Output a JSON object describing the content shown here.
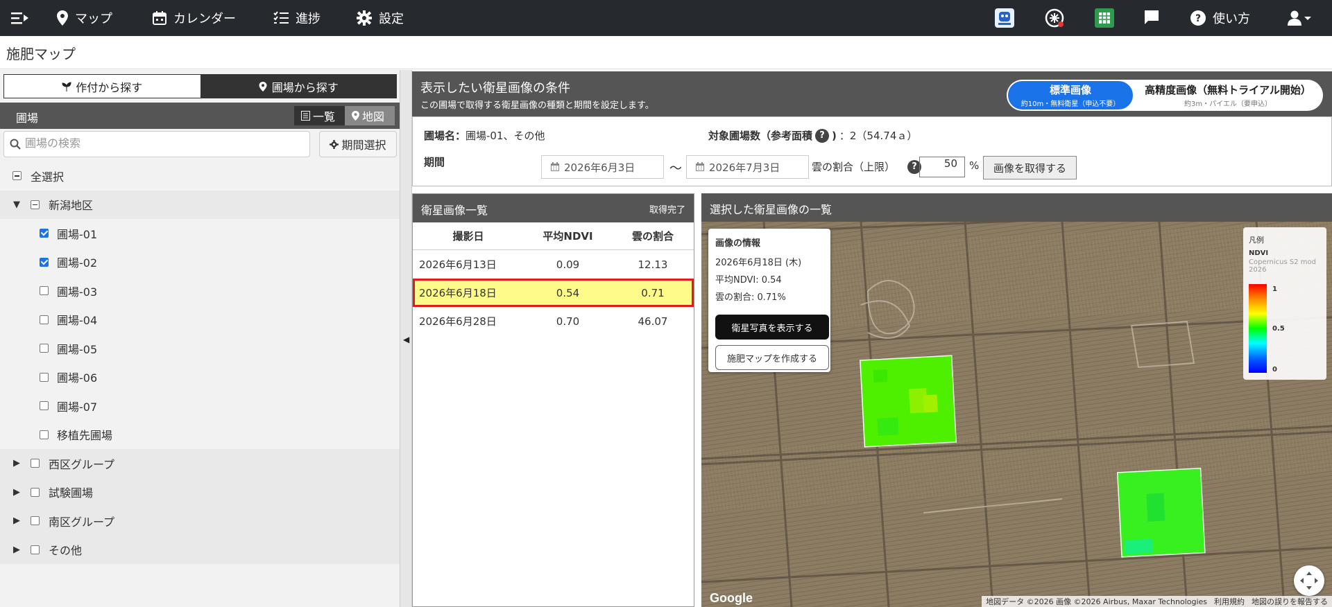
{
  "nav": {
    "map": "マップ",
    "calendar": "カレンダー",
    "progress": "進捗",
    "settings": "設定",
    "help": "使い方"
  },
  "page_title": "施肥マップ",
  "sidebar": {
    "tab_crop": "作付から探す",
    "tab_field": "圃場から探す",
    "section_label": "圃場",
    "view_list": "一覧",
    "view_map": "地図",
    "search_placeholder": "圃場の検索",
    "period_button": "期間選択",
    "tree": [
      {
        "label": "全選択",
        "level": 0,
        "state": "indet",
        "arrow": "",
        "shade": false
      },
      {
        "label": "新潟地区",
        "level": 1,
        "state": "indet",
        "arrow": "▼",
        "shade": true
      },
      {
        "label": "圃場-01",
        "level": 2,
        "state": "checked",
        "arrow": "",
        "shade": false
      },
      {
        "label": "圃場-02",
        "level": 2,
        "state": "checked",
        "arrow": "",
        "shade": false
      },
      {
        "label": "圃場-03",
        "level": 2,
        "state": "unchecked",
        "arrow": "",
        "shade": false
      },
      {
        "label": "圃場-04",
        "level": 2,
        "state": "unchecked",
        "arrow": "",
        "shade": false
      },
      {
        "label": "圃場-05",
        "level": 2,
        "state": "unchecked",
        "arrow": "",
        "shade": false
      },
      {
        "label": "圃場-06",
        "level": 2,
        "state": "unchecked",
        "arrow": "",
        "shade": false
      },
      {
        "label": "圃場-07",
        "level": 2,
        "state": "unchecked",
        "arrow": "",
        "shade": false
      },
      {
        "label": "移植先圃場",
        "level": 2,
        "state": "unchecked",
        "arrow": "",
        "shade": false
      },
      {
        "label": "西区グループ",
        "level": 1,
        "state": "unchecked",
        "arrow": "▶",
        "shade": true
      },
      {
        "label": "試験圃場",
        "level": 1,
        "state": "unchecked",
        "arrow": "▶",
        "shade": true
      },
      {
        "label": "南区グループ",
        "level": 1,
        "state": "unchecked",
        "arrow": "▶",
        "shade": true
      },
      {
        "label": "その他",
        "level": 1,
        "state": "unchecked",
        "arrow": "▶",
        "shade": true
      }
    ]
  },
  "conditions": {
    "title": "表示したい衛星画像の条件",
    "subtitle": "この圃場で取得する衛星画像の種類と期間を設定します。",
    "toggle_standard": "標準画像",
    "toggle_standard_sub": "約10m・無料衛星（申込不要）",
    "toggle_hires": "高精度画像（無料トライアル開始）",
    "toggle_hires_sub": "約3m・パイエル（要申込）",
    "field_name_label": "圃場名：",
    "field_name_value": "圃場-01、その他",
    "target_count_label": "対象圃場数（参考面積",
    "target_count_value": "：2（54.74ａ）",
    "period_label": "期間",
    "date_from": "2026年6月3日",
    "tilde": "～",
    "date_to": "2026年7月3日",
    "cloud_label": "雲の割合（上限）",
    "cloud_value": "50",
    "percent": "%",
    "get_button": "画像を取得する"
  },
  "satellite_list": {
    "title": "衛星画像一覧",
    "status": "取得完了",
    "headers": [
      "撮影日",
      "平均NDVI",
      "雲の割合"
    ],
    "rows": [
      {
        "date": "2026年6月13日",
        "ndvi": "0.09",
        "cloud": "12.13",
        "selected": false
      },
      {
        "date": "2026年6月18日",
        "ndvi": "0.54",
        "cloud": "0.71",
        "selected": true
      },
      {
        "date": "2026年6月28日",
        "ndvi": "0.70",
        "cloud": "46.07",
        "selected": false
      }
    ]
  },
  "map_panel": {
    "title": "選択した衛星画像の一覧",
    "info_title": "画像の情報",
    "info_date": "2026年6月18日 (木)",
    "info_ndvi": "平均NDVI: 0.54",
    "info_cloud": "雲の割合: 0.71%",
    "show_photo_button": "衛星写真を表示する",
    "create_map_button": "施肥マップを作成する",
    "legend_title": "凡例",
    "legend_layer": "NDVI",
    "legend_source": "Copernicus S2 mod 2026",
    "legend_max": "1",
    "legend_mid": "0.5",
    "legend_min": "0",
    "google": "Google",
    "attribution": "地図データ ©2026 画像 ©2026 Airbus, Maxar Technologies",
    "terms": "利用規約",
    "report": "地図の誤りを報告する"
  }
}
